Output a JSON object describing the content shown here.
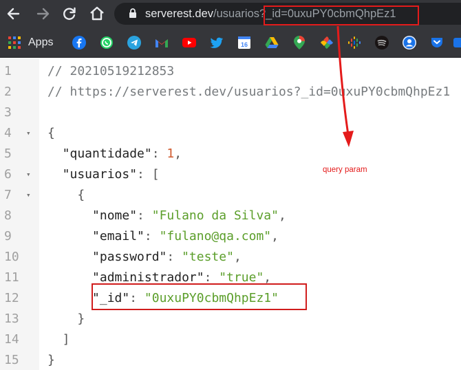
{
  "browser": {
    "url_host": "serverest.dev",
    "url_path": "/usuarios?_id=0uxuPY0cbmQhpEz1",
    "bookmarks_label": "Apps",
    "bookmark_icons": [
      "facebook-icon",
      "whatsapp-icon",
      "telegram-icon",
      "gmail-icon",
      "youtube-icon",
      "twitter-icon",
      "calendar-icon",
      "drive-icon",
      "maps-icon",
      "photos-icon",
      "podcasts-icon",
      "spotify-icon",
      "profile-icon",
      "pocket-icon",
      "extension-icon"
    ],
    "calendar_day": "16"
  },
  "viewer": {
    "lines": [
      {
        "n": "1",
        "fold": false,
        "segments": [
          {
            "t": "// 20210519212853",
            "c": "comment"
          }
        ]
      },
      {
        "n": "2",
        "fold": false,
        "segments": [
          {
            "t": "// https://serverest.dev/usuarios?_id=0uxuPY0cbmQhpEz1",
            "c": "comment"
          }
        ]
      },
      {
        "n": "3",
        "fold": false,
        "segments": []
      },
      {
        "n": "4",
        "fold": true,
        "segments": [
          {
            "t": "{",
            "c": "brace"
          }
        ]
      },
      {
        "n": "5",
        "fold": false,
        "segments": [
          {
            "t": "  \"quantidade\"",
            "c": "key"
          },
          {
            "t": ": ",
            "c": "punct"
          },
          {
            "t": "1",
            "c": "num"
          },
          {
            "t": ",",
            "c": "punct"
          }
        ]
      },
      {
        "n": "6",
        "fold": true,
        "segments": [
          {
            "t": "  \"usuarios\"",
            "c": "key"
          },
          {
            "t": ": [",
            "c": "punct"
          }
        ]
      },
      {
        "n": "7",
        "fold": true,
        "segments": [
          {
            "t": "    {",
            "c": "brace"
          }
        ]
      },
      {
        "n": "8",
        "fold": false,
        "segments": [
          {
            "t": "      \"nome\"",
            "c": "key"
          },
          {
            "t": ": ",
            "c": "punct"
          },
          {
            "t": "\"Fulano da Silva\"",
            "c": "str"
          },
          {
            "t": ",",
            "c": "punct"
          }
        ]
      },
      {
        "n": "9",
        "fold": false,
        "segments": [
          {
            "t": "      \"email\"",
            "c": "key"
          },
          {
            "t": ": ",
            "c": "punct"
          },
          {
            "t": "\"fulano@qa.com\"",
            "c": "str"
          },
          {
            "t": ",",
            "c": "punct"
          }
        ]
      },
      {
        "n": "10",
        "fold": false,
        "segments": [
          {
            "t": "      \"password\"",
            "c": "key"
          },
          {
            "t": ": ",
            "c": "punct"
          },
          {
            "t": "\"teste\"",
            "c": "str"
          },
          {
            "t": ",",
            "c": "punct"
          }
        ]
      },
      {
        "n": "11",
        "fold": false,
        "segments": [
          {
            "t": "      \"administrador\"",
            "c": "key"
          },
          {
            "t": ": ",
            "c": "punct"
          },
          {
            "t": "\"true\"",
            "c": "str"
          },
          {
            "t": ",",
            "c": "punct"
          }
        ]
      },
      {
        "n": "12",
        "fold": false,
        "segments": [
          {
            "t": "      \"_id\"",
            "c": "key"
          },
          {
            "t": ": ",
            "c": "punct"
          },
          {
            "t": "\"0uxuPY0cbmQhpEz1\"",
            "c": "str"
          }
        ]
      },
      {
        "n": "13",
        "fold": false,
        "segments": [
          {
            "t": "    }",
            "c": "brace"
          }
        ]
      },
      {
        "n": "14",
        "fold": false,
        "segments": [
          {
            "t": "  ]",
            "c": "punct"
          }
        ]
      },
      {
        "n": "15",
        "fold": false,
        "segments": [
          {
            "t": "}",
            "c": "brace"
          }
        ]
      }
    ]
  },
  "annotation": {
    "label": "query param",
    "color": "#e41b1b"
  }
}
